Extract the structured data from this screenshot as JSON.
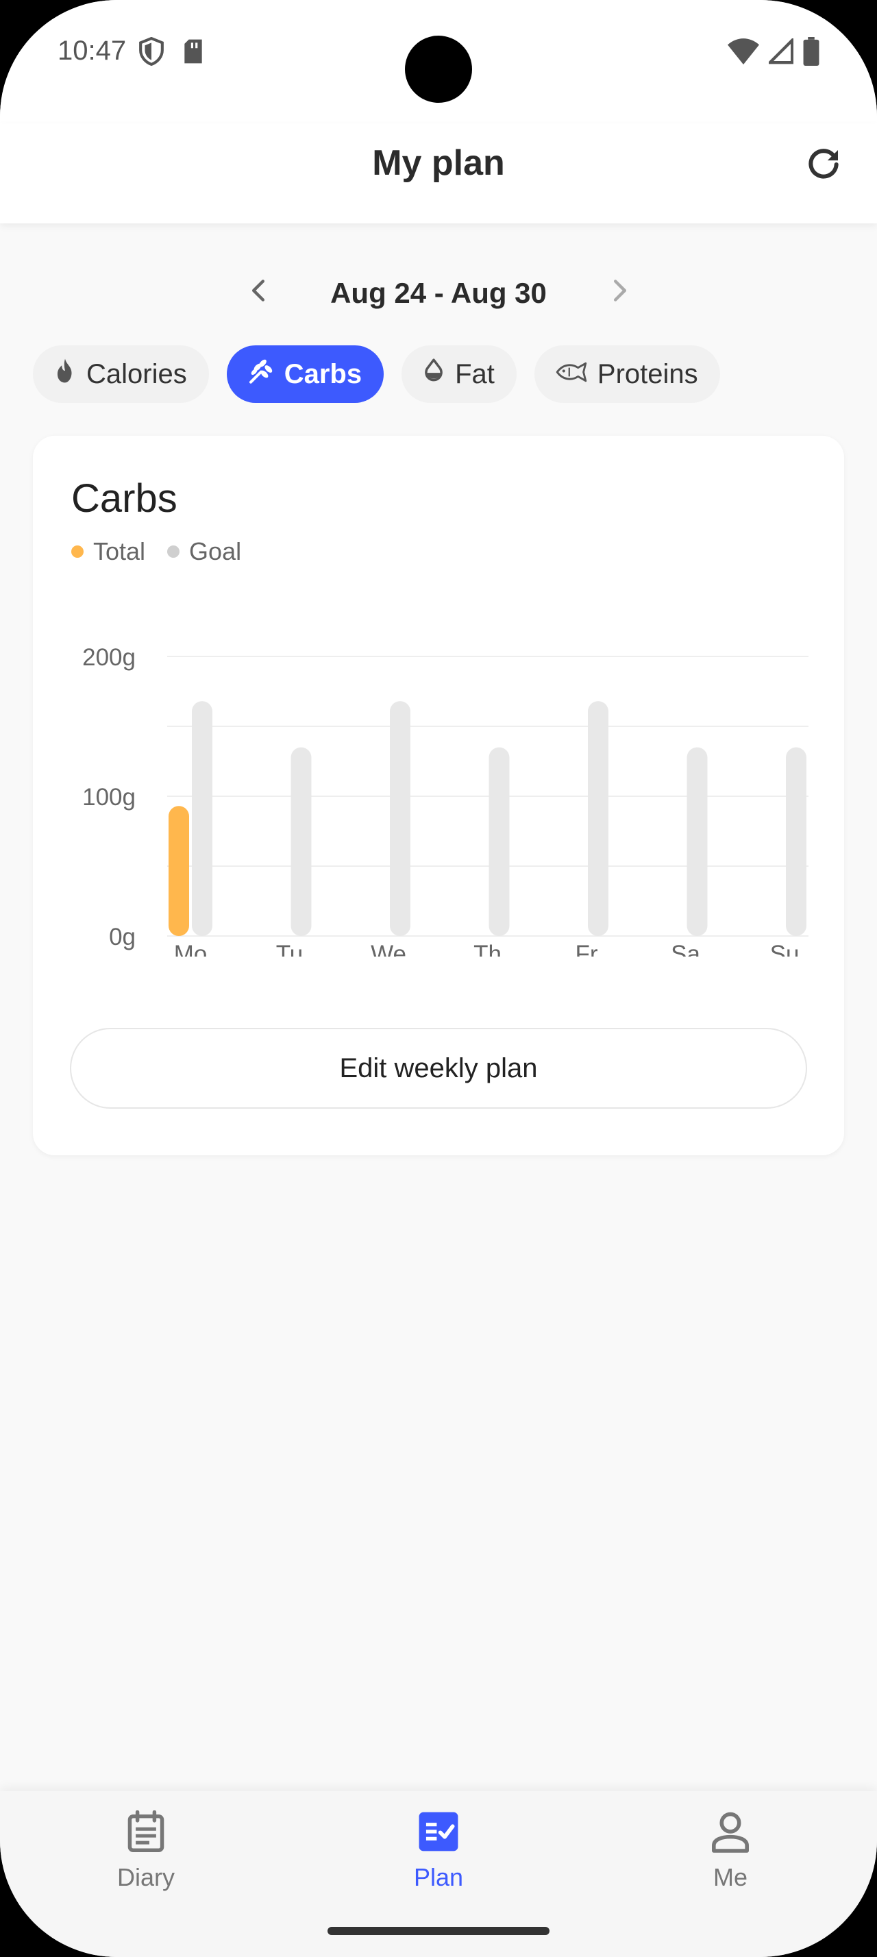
{
  "status": {
    "time": "10:47",
    "left_icons": [
      "shield-icon",
      "sd-card-icon"
    ],
    "right_icons": [
      "wifi-icon",
      "signal-icon",
      "battery-icon"
    ]
  },
  "app_bar": {
    "title": "My plan",
    "refresh_icon": "refresh-icon"
  },
  "date_nav": {
    "range": "Aug 24 - Aug 30"
  },
  "chips": [
    {
      "label": "Calories",
      "icon": "flame-icon",
      "active": false
    },
    {
      "label": "Carbs",
      "icon": "wheat-icon",
      "active": true
    },
    {
      "label": "Fat",
      "icon": "drop-icon",
      "active": false
    },
    {
      "label": "Proteins",
      "icon": "fish-icon",
      "active": false
    }
  ],
  "card": {
    "title": "Carbs",
    "legend": [
      {
        "label": "Total",
        "color": "#ffb74d"
      },
      {
        "label": "Goal",
        "color": "#cfcfcf"
      }
    ],
    "edit_button": "Edit weekly plan"
  },
  "chart_data": {
    "type": "bar",
    "categories": [
      "Mo",
      "Tu",
      "We",
      "Th",
      "Fr",
      "Sa",
      "Su"
    ],
    "series": [
      {
        "name": "Total",
        "color": "#ffb74d",
        "values": [
          93,
          0,
          0,
          0,
          0,
          0,
          0
        ]
      },
      {
        "name": "Goal",
        "color": "#e8e8e8",
        "values": [
          168,
          135,
          168,
          135,
          168,
          135,
          135
        ]
      }
    ],
    "y_ticks": [
      {
        "value": 0,
        "label": "0g"
      },
      {
        "value": 100,
        "label": "100g"
      },
      {
        "value": 200,
        "label": "200g"
      }
    ],
    "ylim": [
      0,
      200
    ],
    "grid": true
  },
  "bottom_nav": [
    {
      "label": "Diary",
      "icon": "diary-icon",
      "active": false
    },
    {
      "label": "Plan",
      "icon": "plan-checklist-icon",
      "active": true
    },
    {
      "label": "Me",
      "icon": "person-icon",
      "active": false
    }
  ]
}
